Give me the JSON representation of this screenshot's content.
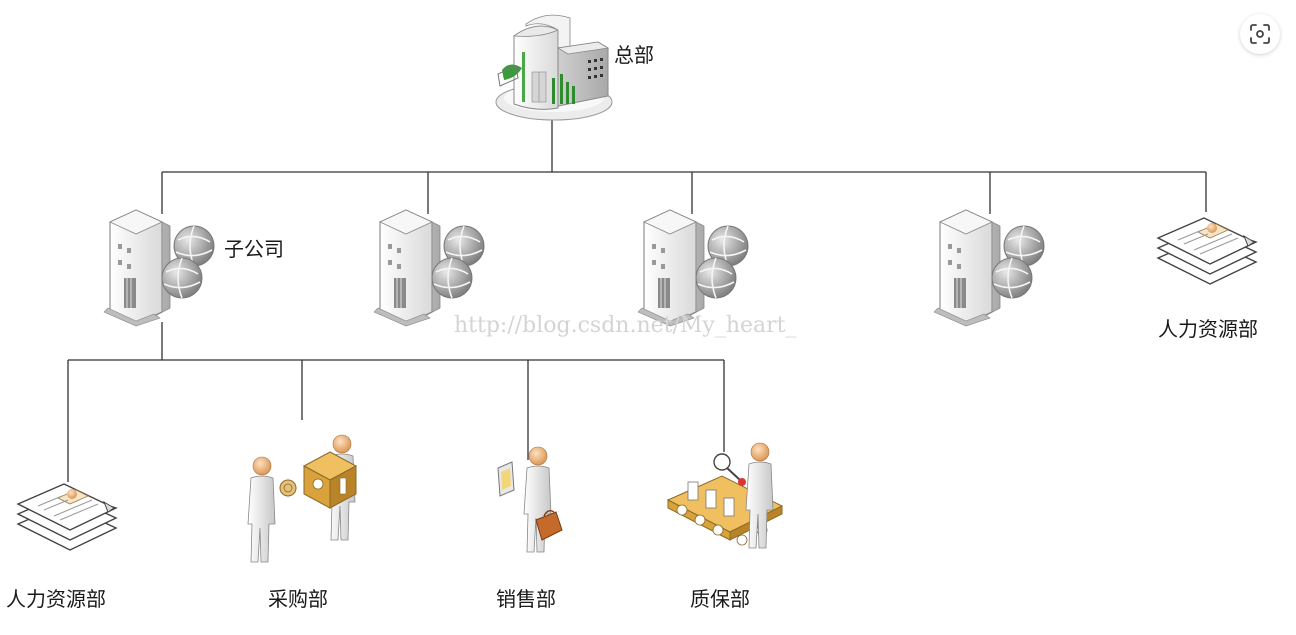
{
  "diagram": {
    "headquarters": {
      "label": "总部",
      "icon": "headquarters-building-icon"
    },
    "subsidiary": {
      "label": "子公司",
      "icon": "office-building-globe-icon"
    },
    "hq_hr": {
      "label": "人力资源部",
      "icon": "documents-stack-icon"
    },
    "departments": [
      {
        "label": "人力资源部",
        "icon": "documents-stack-icon"
      },
      {
        "label": "采购部",
        "icon": "purchasing-people-box-icon"
      },
      {
        "label": "销售部",
        "icon": "salesperson-briefcase-icon"
      },
      {
        "label": "质保部",
        "icon": "quality-inspector-conveyor-icon"
      }
    ],
    "watermark": "http://blog.csdn.net/My_heart_"
  },
  "toolbar": {
    "lens_icon": "image-search-icon"
  },
  "colors": {
    "line": "#333333",
    "building": "#f4f4f4",
    "globe": "#9a9a9a",
    "skin": "#f0b07a",
    "box": "#d9a23a",
    "green": "#3a9b3a"
  }
}
